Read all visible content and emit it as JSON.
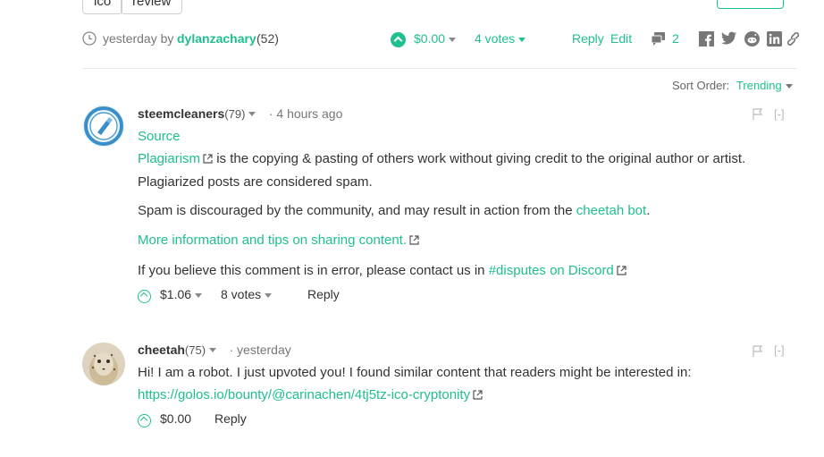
{
  "tags": [
    "ico",
    "review"
  ],
  "post": {
    "time": "yesterday by",
    "author": "dylanzachary",
    "rep": "(52)",
    "payout": "$0.00",
    "votes": "4 votes",
    "reply": "Reply",
    "edit": "Edit",
    "comment_count": "2"
  },
  "sort": {
    "label": "Sort Order:",
    "value": "Trending"
  },
  "comments": [
    {
      "author": "steemcleaners",
      "rep": "(79)",
      "time": "· 4 hours ago",
      "collapse": "[-]",
      "source_link": "Source",
      "plag_link": "Plagiarism",
      "plag_rest": " is the copying & pasting of others work without giving credit to the original author or artist.",
      "plag_line2": "Plagiarized posts are considered spam.",
      "spam_pre": "Spam is discouraged by the community, and may result in action from the ",
      "spam_link": "cheetah bot",
      "spam_post": ".",
      "more_link": "More information and tips on sharing content.",
      "dispute_pre": "If you believe this comment is in error, please contact us in ",
      "dispute_link": "#disputes on Discord",
      "payout": "$1.06",
      "votes": "8 votes",
      "reply": "Reply"
    },
    {
      "author": "cheetah",
      "rep": "(75)",
      "time": "· yesterday",
      "collapse": "[-]",
      "text": "Hi! I am a robot. I just upvoted you! I found similar content that readers might be interested in:",
      "link": "https://golos.io/bounty/@carinachen/4tj5tz-ico-cryptonity",
      "payout": "$0.00",
      "reply": "Reply"
    }
  ],
  "colors": {
    "accent": "#1fbf8f",
    "text": "#333333",
    "muted": "#777777"
  }
}
